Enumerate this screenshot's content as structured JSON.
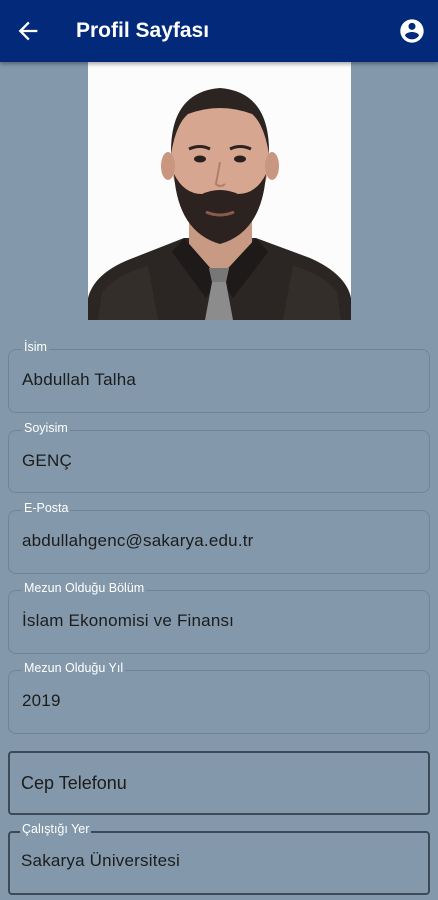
{
  "app_bar": {
    "title": "Profil Sayfası",
    "back_icon": "arrow-left-icon",
    "account_icon": "account-circle-icon",
    "background_color": "#032a7a"
  },
  "profile": {
    "photo_icon": "profile-photo"
  },
  "fields": {
    "first_name": {
      "label": "İsim",
      "value": "Abdullah Talha"
    },
    "last_name": {
      "label": "Soyisim",
      "value": "GENÇ"
    },
    "email": {
      "label": "E-Posta",
      "value": "abdullahgenc@sakarya.edu.tr"
    },
    "department": {
      "label": "Mezun Olduğu Bölüm",
      "value": "İslam Ekonomisi ve Finansı"
    },
    "graduation_year": {
      "label": "Mezun Olduğu Yıl",
      "value": "2019"
    },
    "phone": {
      "placeholder": "Cep Telefonu"
    },
    "workplace": {
      "label": "Çalıştığı Yer",
      "value": "Sakarya Üniversitesi"
    }
  },
  "colors": {
    "page_background": "#8399ab"
  }
}
